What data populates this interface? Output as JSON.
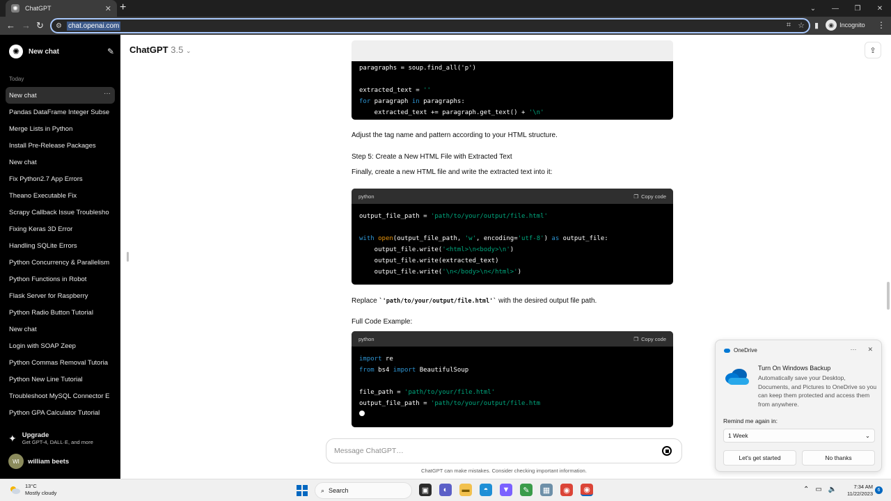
{
  "browser": {
    "tab_title": "ChatGPT",
    "url": "chat.openai.com",
    "incognito_label": "Incognito"
  },
  "sidebar": {
    "new_chat_label": "New chat",
    "section_label": "Today",
    "items": [
      {
        "label": "New chat",
        "active": true
      },
      {
        "label": "Pandas DataFrame Integer Subse"
      },
      {
        "label": "Merge Lists in Python"
      },
      {
        "label": "Install Pre-Release Packages"
      },
      {
        "label": "New chat"
      },
      {
        "label": "Fix Python2.7 App Errors"
      },
      {
        "label": "Theano Executable Fix"
      },
      {
        "label": "Scrapy Callback Issue Troublesho"
      },
      {
        "label": "Fixing Keras 3D Error"
      },
      {
        "label": "Handling SQLite Errors"
      },
      {
        "label": "Python Concurrency & Parallelism"
      },
      {
        "label": "Python Functions in Robot"
      },
      {
        "label": "Flask Server for Raspberry"
      },
      {
        "label": "Python Radio Button Tutorial"
      },
      {
        "label": "New chat"
      },
      {
        "label": "Login with SOAP Zeep"
      },
      {
        "label": "Python Commas Removal Tutoria"
      },
      {
        "label": "Python New Line Tutorial"
      },
      {
        "label": "Troubleshoot MySQL Connector E"
      },
      {
        "label": "Python GPA Calculator Tutorial"
      }
    ],
    "upgrade_title": "Upgrade",
    "upgrade_subtitle": "Get GPT-4, DALL·E, and more",
    "user_initials": "WI",
    "user_name": "william beets"
  },
  "header": {
    "model_name": "ChatGPT",
    "model_version": "3.5"
  },
  "conversation": {
    "block1_lines": [
      "paragraphs = soup.find_all('p')",
      "",
      "extracted_text = ''",
      "for paragraph in paragraphs:",
      "    extracted_text += paragraph.get_text() + '\\n'"
    ],
    "para_adjust": "Adjust the tag name and pattern according to your HTML structure.",
    "step5_heading": "Step 5: Create a New HTML File with Extracted Text",
    "step5_intro": "Finally, create a new HTML file and write the extracted text into it:",
    "code_language": "python",
    "copy_label": "Copy code",
    "replace_prefix": "Replace ",
    "replace_code": "`'path/to/your/output/file.html'`",
    "replace_suffix": " with the desired output file path.",
    "full_code_heading": "Full Code Example:"
  },
  "composer": {
    "placeholder": "Message ChatGPT…",
    "disclaimer": "ChatGPT can make mistakes. Consider checking important information."
  },
  "toast": {
    "app_name": "OneDrive",
    "title": "Turn On Windows Backup",
    "body": "Automatically save your Desktop, Documents, and Pictures to OneDrive so you can keep them protected and access them from anywhere.",
    "remind_label": "Remind me again in:",
    "remind_value": "1 Week",
    "primary_button": "Let's get started",
    "secondary_button": "No thanks"
  },
  "taskbar": {
    "temperature": "13°C",
    "weather_desc": "Mostly cloudy",
    "search_label": "Search",
    "time": "7:34 AM",
    "date": "11/22/2023",
    "notification_count": "6"
  },
  "colors": {
    "sidebar_bg": "#000000",
    "code_keyword": "#2e95d3",
    "code_string": "#00a67d",
    "code_function": "#e9950c",
    "windows_accent": "#0067c0"
  }
}
